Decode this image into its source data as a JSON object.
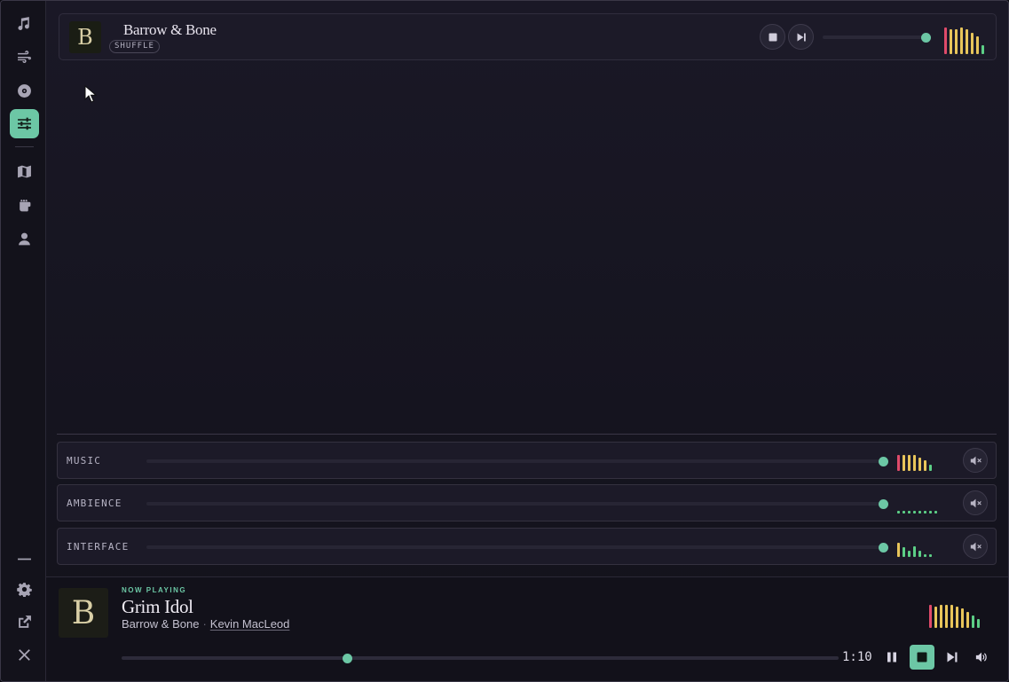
{
  "colors": {
    "accent": "#6cc7a5",
    "meter_red": "#e04a6a",
    "meter_yellow": "#e8c55a",
    "meter_green": "#5ccf86"
  },
  "sidebar": {
    "items": [
      {
        "icon": "music-note-icon",
        "active": false
      },
      {
        "icon": "wind-icon",
        "active": false
      },
      {
        "icon": "disc-icon",
        "active": false
      },
      {
        "icon": "sliders-icon",
        "active": true
      },
      {
        "icon": "map-icon",
        "active": false
      },
      {
        "icon": "fist-icon",
        "active": false
      },
      {
        "icon": "user-icon",
        "active": false
      }
    ],
    "bottom": [
      "minimize-icon",
      "gear-icon",
      "external-link-icon",
      "close-icon"
    ]
  },
  "track_card": {
    "cover_letter": "B",
    "title": "Barrow & Bone",
    "badge": "SHUFFLE",
    "volume": 0.97
  },
  "mixer": {
    "channels": [
      {
        "label": "MUSIC",
        "volume": 1.0
      },
      {
        "label": "AMBIENCE",
        "volume": 1.0
      },
      {
        "label": "INTERFACE",
        "volume": 1.0
      }
    ]
  },
  "player": {
    "cover_letter": "B",
    "now_playing_label": "NOW PLAYING",
    "title": "Grim Idol",
    "album": "Barrow & Bone",
    "separator": "·",
    "artist": "Kevin MacLeod",
    "progress": 0.315,
    "time": "1:10"
  }
}
